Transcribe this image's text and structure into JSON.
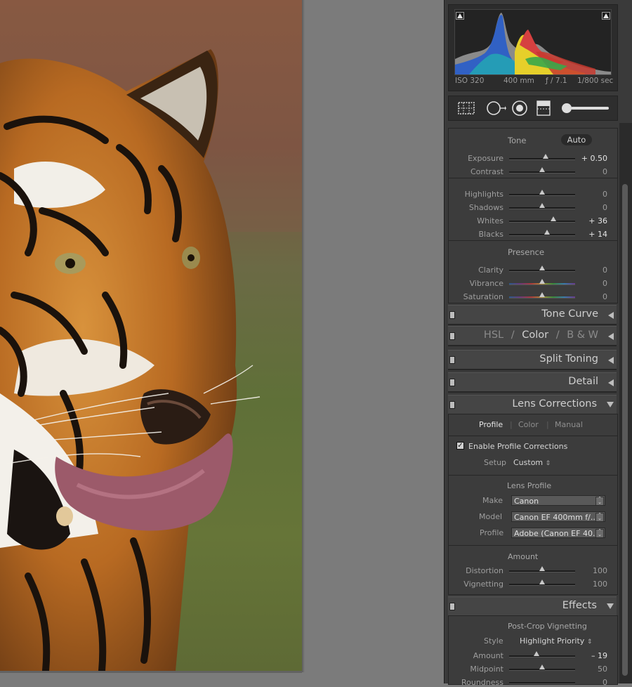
{
  "histogram": {
    "iso": "ISO 320",
    "focal": "400 mm",
    "aperture": "ƒ / 7.1",
    "shutter": "1/800 sec"
  },
  "tools": [
    "crop-overlay-icon",
    "spot-removal-icon",
    "red-eye-icon",
    "graduated-filter-icon",
    "adjustment-brush-icon"
  ],
  "basic": {
    "tone_label": "Tone",
    "auto_label": "Auto",
    "presence_label": "Presence",
    "rows": [
      {
        "label": "Exposure",
        "value": "+ 0.50",
        "pos": 0.55
      },
      {
        "label": "Contrast",
        "value": "0",
        "pos": 0.5
      },
      {
        "label": "Highlights",
        "value": "0",
        "pos": 0.5
      },
      {
        "label": "Shadows",
        "value": "0",
        "pos": 0.5
      },
      {
        "label": "Whites",
        "value": "+ 36",
        "pos": 0.67
      },
      {
        "label": "Blacks",
        "value": "+ 14",
        "pos": 0.57
      },
      {
        "label": "Clarity",
        "value": "0",
        "pos": 0.5
      },
      {
        "label": "Vibrance",
        "value": "0",
        "pos": 0.5
      },
      {
        "label": "Saturation",
        "value": "0",
        "pos": 0.5
      }
    ]
  },
  "panels": {
    "tone_curve": "Tone Curve",
    "hsl": "HSL",
    "hsl_sep1": "/",
    "color": "Color",
    "hsl_sep2": "/",
    "bw": "B & W",
    "split_toning": "Split Toning",
    "detail": "Detail",
    "lens_corrections": "Lens Corrections",
    "effects": "Effects"
  },
  "lens": {
    "tabs": [
      "Profile",
      "Color",
      "Manual"
    ],
    "enable_label": "Enable Profile Corrections",
    "enable_checked": true,
    "setup_label": "Setup",
    "setup_value": "Custom",
    "lens_profile_label": "Lens Profile",
    "make_label": "Make",
    "make_value": "Canon",
    "model_label": "Model",
    "model_value": "Canon EF 400mm f/...",
    "profile_label": "Profile",
    "profile_value": "Adobe (Canon EF 40...",
    "amount_label": "Amount",
    "distortion_label": "Distortion",
    "distortion_value": "100",
    "vignetting_label": "Vignetting",
    "vignetting_value": "100"
  },
  "effects": {
    "section_label": "Post-Crop Vignetting",
    "style_label": "Style",
    "style_value": "Highlight Priority",
    "amount_label": "Amount",
    "amount_value": "– 19",
    "midpoint_label": "Midpoint",
    "midpoint_value": "50",
    "roundness_label": "Roundness",
    "roundness_value": "0"
  }
}
